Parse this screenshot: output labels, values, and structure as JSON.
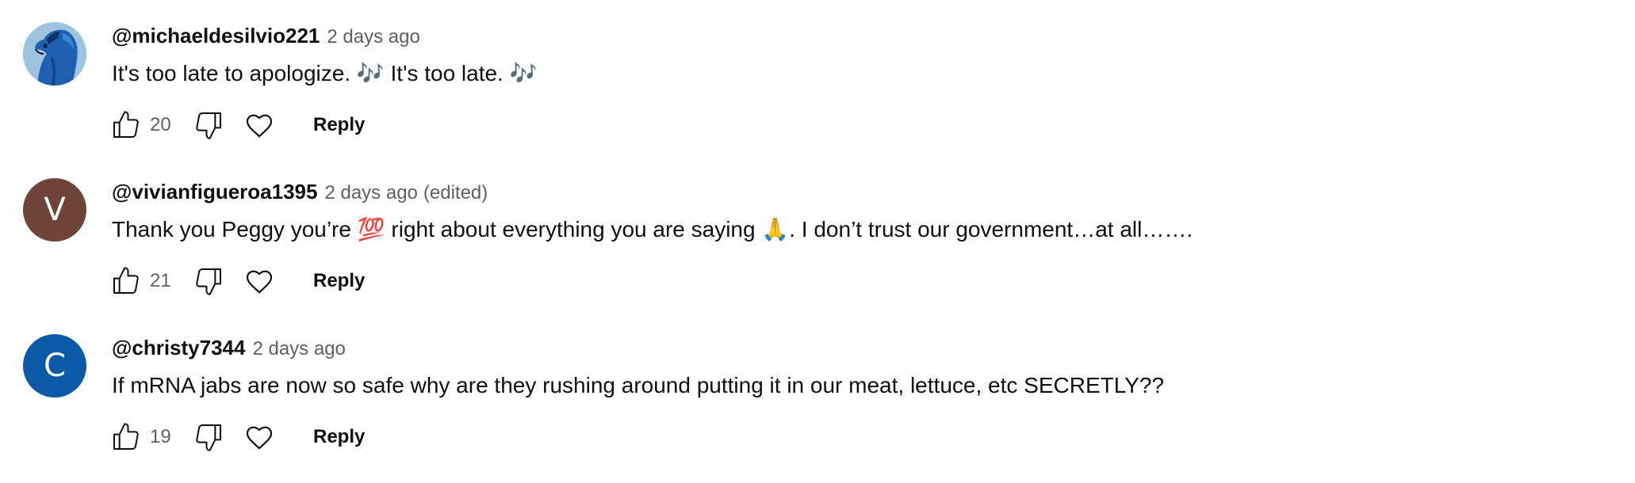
{
  "comments": [
    {
      "author": "@michaeldesilvio221",
      "time": "2 days ago",
      "edited": "",
      "text_parts": [
        "It's too late to apologize. ",
        "🎶",
        " It's too late. ",
        "🎶",
        ""
      ],
      "likes": "20",
      "reply_label": "Reply",
      "avatar": {
        "type": "image",
        "icon": "blue-horse-icon",
        "bg": "#8fb8d8"
      }
    },
    {
      "author": "@vivianfigueroa1395",
      "time": "2 days ago",
      "edited": "(edited)",
      "text_parts": [
        "Thank you Peggy you’re ",
        "💯",
        " right about everything you are saying ",
        "🙏",
        ".  I don’t trust our government…at all……."
      ],
      "likes": "21",
      "reply_label": "Reply",
      "avatar": {
        "type": "letter",
        "letter": "V",
        "bg": "#6d4437"
      }
    },
    {
      "author": "@christy7344",
      "time": "2 days ago",
      "edited": "",
      "text_parts": [
        "If mRNA jabs are now so safe why are they rushing around putting it in our meat, lettuce, etc SECRETLY??",
        "",
        "",
        "",
        ""
      ],
      "likes": "19",
      "reply_label": "Reply",
      "avatar": {
        "type": "letter",
        "letter": "C",
        "bg": "#0b5aa6"
      }
    }
  ]
}
